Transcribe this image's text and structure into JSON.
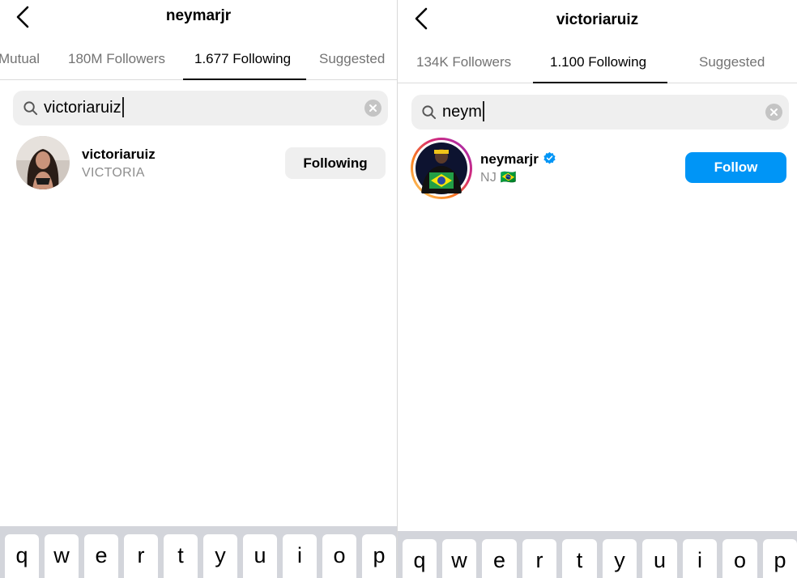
{
  "left": {
    "title": "neymarjr",
    "tabs": [
      {
        "label": "Mutual",
        "active": false
      },
      {
        "label": "180M Followers",
        "active": false
      },
      {
        "label": "1.677 Following",
        "active": true
      },
      {
        "label": "Suggested",
        "active": false
      }
    ],
    "search": {
      "value": "victoriaruiz"
    },
    "result": {
      "username": "victoriaruiz",
      "full_name": "VICTORIA",
      "button_label": "Following"
    },
    "keyboard_keys": [
      "q",
      "w",
      "e",
      "r",
      "t",
      "y",
      "u",
      "i",
      "o",
      "p"
    ]
  },
  "right": {
    "title": "victoriaruiz",
    "tabs": [
      {
        "label": "134K Followers",
        "active": false
      },
      {
        "label": "1.100 Following",
        "active": true
      },
      {
        "label": "Suggested",
        "active": false
      }
    ],
    "search": {
      "value": "neym"
    },
    "result": {
      "username": "neymarjr",
      "full_name": "NJ 🇧🇷",
      "verified": true,
      "button_label": "Follow"
    },
    "keyboard_keys": [
      "q",
      "w",
      "e",
      "r",
      "t",
      "y",
      "u",
      "i",
      "o",
      "p"
    ]
  },
  "colors": {
    "accent": "#0095f6",
    "verified": "#0095f6",
    "muted_text": "#737373",
    "keyboard_bg": "#d3d5db"
  }
}
